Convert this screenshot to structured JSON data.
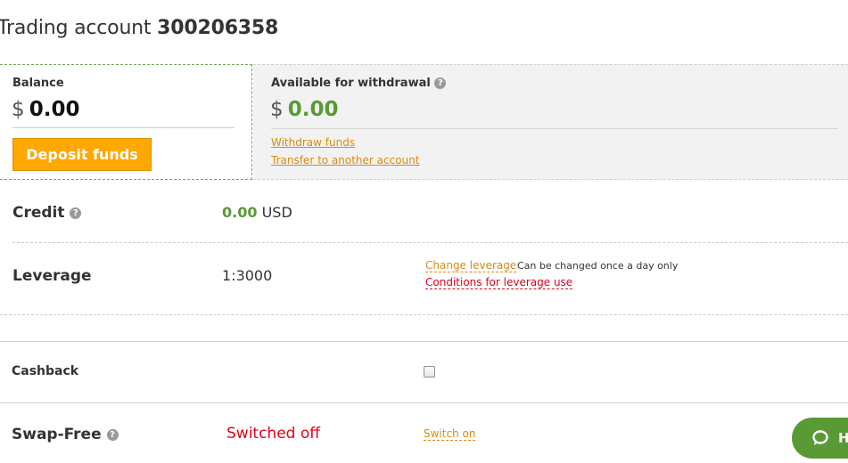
{
  "header": {
    "title_prefix": "Trading account",
    "account_number": "300206358"
  },
  "balance": {
    "label": "Balance",
    "currency_symbol": "$",
    "amount": "0.00",
    "deposit_button": "Deposit funds"
  },
  "withdrawal": {
    "label": "Available for withdrawal",
    "help": "?",
    "currency_symbol": "$",
    "amount": "0.00",
    "links": [
      "Withdraw funds",
      "Transfer to another account"
    ]
  },
  "credit": {
    "label": "Credit",
    "help": "?",
    "amount": "0.00",
    "currency": "USD"
  },
  "leverage": {
    "label": "Leverage",
    "value": "1:3000",
    "change_link": "Change leverage",
    "note": "Can be changed once a day only",
    "conditions_link": "Conditions for leverage use"
  },
  "cashback": {
    "label": "Cashback",
    "checked": false
  },
  "swap_free": {
    "label": "Swap-Free",
    "help": "?",
    "status": "Switched off",
    "action_link": "Switch on"
  },
  "help_chat": {
    "label": "H",
    "icon": "chat-bubble-icon"
  },
  "colors": {
    "accent_green": "#5a9a35",
    "button_orange": "#ffa800",
    "link_orange": "#d98b12",
    "alert_red": "#e3001b"
  }
}
